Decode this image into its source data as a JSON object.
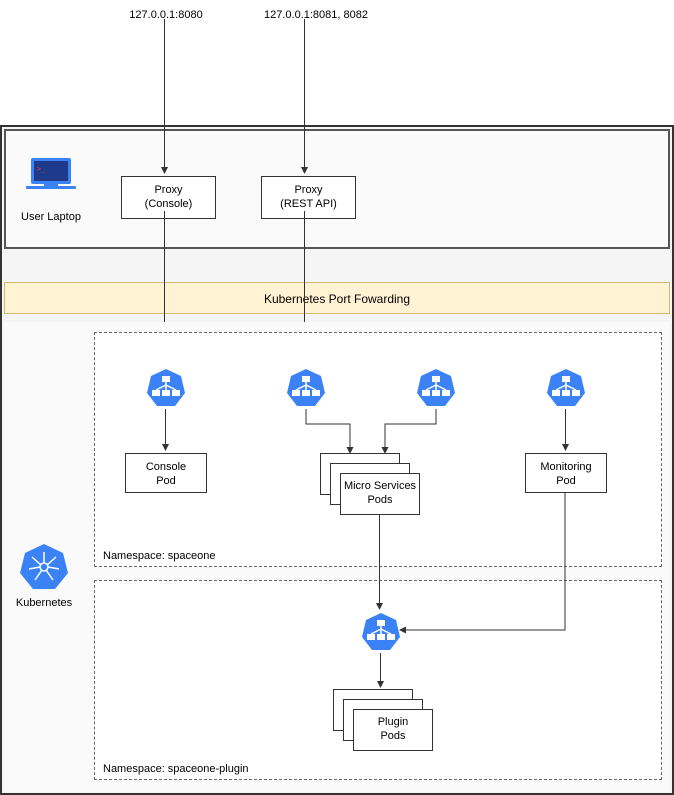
{
  "laptop": {
    "label": "User Laptop",
    "addr1": "127.0.0.1:8080",
    "addr2": "127.0.0.1:8081, 8082",
    "proxy1_line1": "Proxy",
    "proxy1_line2": "(Console)",
    "proxy2_line1": "Proxy",
    "proxy2_line2": "(REST API)"
  },
  "portForward": "Kubernetes Port Fowarding",
  "k8s": {
    "label": "Kubernetes",
    "ns1": "Namespace: spaceone",
    "ns2": "Namespace: spaceone-plugin",
    "console_line1": "Console",
    "console_line2": "Pod",
    "micro_line1": "Micro Services",
    "micro_line2": "Pods",
    "monitoring_line1": "Monitoring",
    "monitoring_line2": "Pod",
    "plugin_line1": "Plugin",
    "plugin_line2": "Pods"
  },
  "colors": {
    "blue": "#3b82f6"
  }
}
